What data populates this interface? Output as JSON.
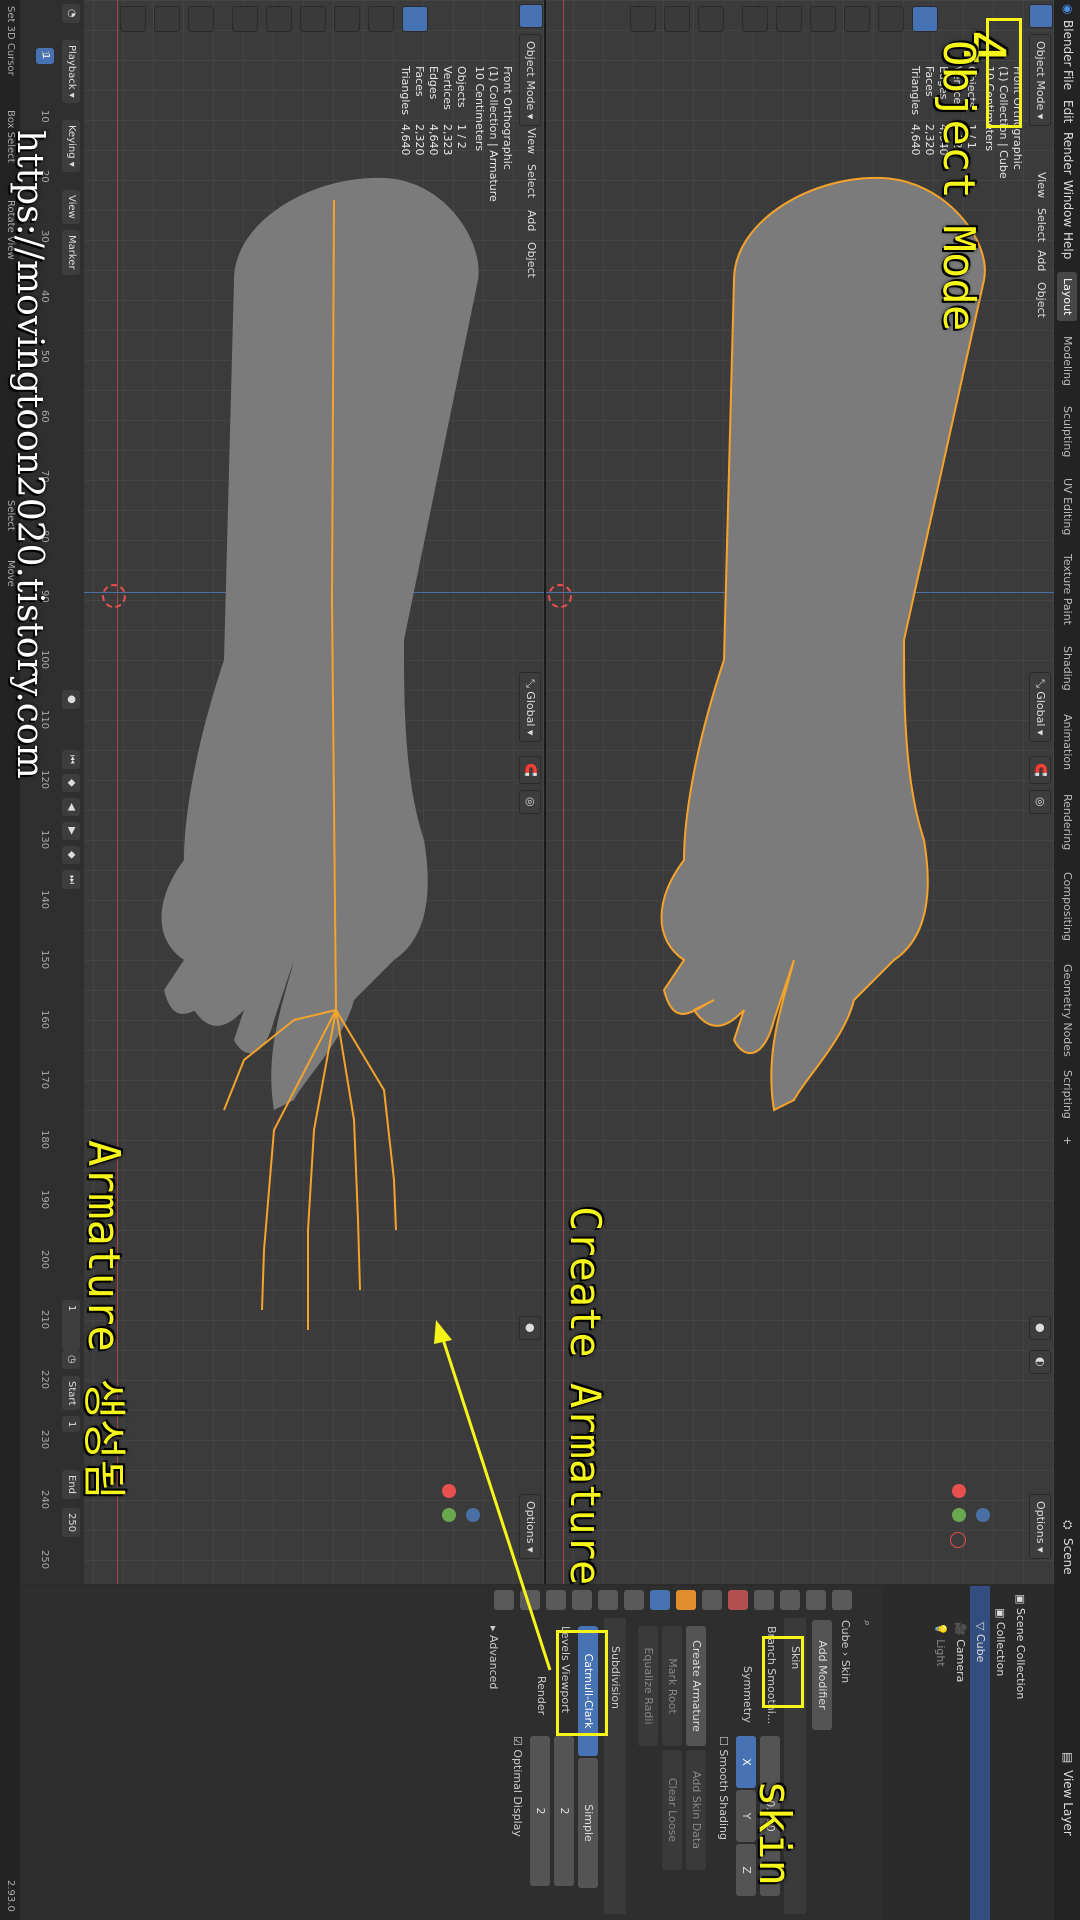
{
  "app": {
    "title": "Blender",
    "version": "2.93"
  },
  "menu": [
    "File",
    "Edit",
    "Render",
    "Window",
    "Help"
  ],
  "workspaces": [
    "Layout",
    "Modeling",
    "Sculpting",
    "UV Editing",
    "Texture Paint",
    "Shading",
    "Animation",
    "Rendering",
    "Compositing",
    "Geometry Nodes",
    "Scripting",
    "+"
  ],
  "active_workspace": "Layout",
  "scene": {
    "label": "Scene",
    "view_layer": "View Layer"
  },
  "viewport_top": {
    "mode": "Object Mode",
    "menus": [
      "View",
      "Select",
      "Add",
      "Object"
    ],
    "transform": "Global",
    "options": "Options",
    "overlay": [
      "Front Orthographic",
      "(1) Collection | Cube",
      "10 Centimeters"
    ],
    "stats": [
      {
        "k": "Objects",
        "v": "1 / 1"
      },
      {
        "k": "Vertices",
        "v": "2,323"
      },
      {
        "k": "Edges",
        "v": "4,640"
      },
      {
        "k": "Faces",
        "v": "2,320"
      },
      {
        "k": "Triangles",
        "v": "4,640"
      }
    ]
  },
  "viewport_bottom": {
    "mode": "Object Mode",
    "menus": [
      "View",
      "Select",
      "Add",
      "Object"
    ],
    "transform": "Global",
    "options": "Options",
    "overlay": [
      "Front Orthographic",
      "(1) Collection | Armature",
      "10 Centimeters"
    ],
    "stats": [
      {
        "k": "Objects",
        "v": "1 / 2"
      },
      {
        "k": "Vertices",
        "v": "2,323"
      },
      {
        "k": "Edges",
        "v": "4,640"
      },
      {
        "k": "Faces",
        "v": "2,320"
      },
      {
        "k": "Triangles",
        "v": "4,640"
      }
    ]
  },
  "timeline": {
    "menus": [
      "Playback",
      "Keying",
      "View",
      "Marker"
    ],
    "ticks": [
      "1",
      "10",
      "20",
      "30",
      "40",
      "50",
      "60",
      "70",
      "80",
      "90",
      "100",
      "110",
      "120",
      "130",
      "140",
      "150",
      "160",
      "170",
      "180",
      "190",
      "200",
      "210",
      "220",
      "230",
      "240",
      "250"
    ],
    "current_frame": "1",
    "frame_field": "1",
    "start_label": "Start",
    "start": "1",
    "end_label": "End",
    "end": "250"
  },
  "status_bar": [
    "Set 3D Cursor",
    "Box Select",
    "Rotate View",
    "Select",
    "Move",
    "2.93.0"
  ],
  "outliner": {
    "rows": [
      {
        "name": "Scene Collection",
        "sel": false
      },
      {
        "name": "Collection",
        "sel": false
      },
      {
        "name": "Cube",
        "sel": true
      },
      {
        "name": "Camera",
        "sel": false
      },
      {
        "name": "Light",
        "sel": false
      }
    ]
  },
  "properties": {
    "breadcrumb": [
      "Cube",
      "Skin"
    ],
    "add_modifier": "Add Modifier",
    "skin": {
      "name": "Skin",
      "branch_smoothing_label": "Branch Smoothi...",
      "branch_smoothing_value": "0.000",
      "symmetry_label": "Symmetry",
      "axes": [
        "X",
        "Y",
        "Z"
      ],
      "smooth_shading": "Smooth Shading",
      "create_armature": "Create Armature",
      "add_skin_data": "Add Skin Data",
      "mark_root": "Mark Root",
      "clear_loose": "Clear Loose",
      "equalize_radii": "Equalize Radii"
    },
    "subdivision": {
      "name": "Subdivision",
      "catmull": "Catmull-Clark",
      "simple": "Simple",
      "levels_viewport_label": "Levels Viewport",
      "levels_viewport": "2",
      "render_label": "Render",
      "render": "2",
      "optimal_display": "Optimal Display",
      "advanced": "Advanced"
    }
  },
  "annotations": {
    "step": "4",
    "object_mode": "Object Mode",
    "create_armature": "Create Armature",
    "skin": "skin",
    "armature_created": "Armature 생성됨",
    "watermark": "https://movingtoon2020.tistory.com"
  },
  "colors": {
    "accent": "#4772b3",
    "selection": "#f5a32a",
    "annotation": "#f5f51a"
  }
}
